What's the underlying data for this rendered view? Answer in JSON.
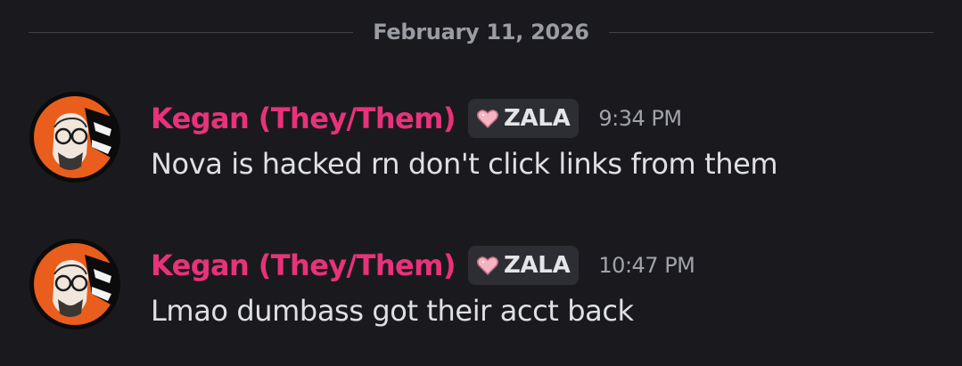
{
  "date_divider": "February 11, 2026",
  "colors": {
    "background": "#1a1a1e",
    "username": "#e8327a",
    "tag_bg": "#2d2e33",
    "heart": "#f7b3c1"
  },
  "messages": [
    {
      "author": "Kegan (They/Them)",
      "tag": "ZALA",
      "tag_icon": "heart-icon",
      "timestamp": "9:34 PM",
      "content": "Nova is hacked rn don't click links from them"
    },
    {
      "author": "Kegan (They/Them)",
      "tag": "ZALA",
      "tag_icon": "heart-icon",
      "timestamp": "10:47 PM",
      "content": "Lmao dumbass got their acct back"
    }
  ]
}
